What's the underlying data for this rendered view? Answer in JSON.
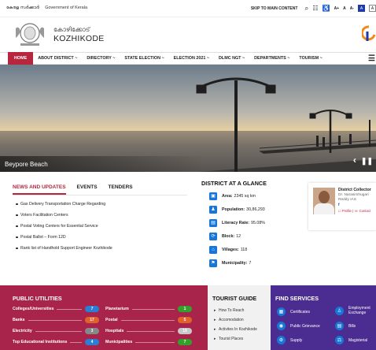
{
  "topbar": {
    "malayalam": "കേരള സർക്കാർ",
    "government": "Government of Kerala",
    "skip": "SKIP TO MAIN CONTENT",
    "font_sizes": [
      "A+",
      "A",
      "A-"
    ],
    "contrast": "A"
  },
  "header": {
    "name_ml": "കോഴിക്കോട്",
    "name_en": "KOZHIKODE"
  },
  "nav": {
    "items": [
      "HOME",
      "ABOUT DISTRICT ~",
      "DIRECTORY ~",
      "STATE ELECTION ~",
      "ELECTION 2021 ~",
      "DLMC NGT ~",
      "DEPARTMENTS ~",
      "TOURISM ~"
    ]
  },
  "hero": {
    "caption": "Beypore Beach"
  },
  "news": {
    "tabs": [
      "NEWS AND UPDATES",
      "EVENTS",
      "TENDERS"
    ],
    "items": [
      "Gas Delivery Transportation Charge Regarding",
      "Voters Facilitation Centers",
      "Postal Voting Centers for Essential Service",
      "Postal Ballot – Form 12D",
      "Rank list of Handhold Support Engineer Kozhikode"
    ]
  },
  "glance": {
    "title": "DISTRICT AT A GLANCE",
    "rows": [
      {
        "label": "Area:",
        "value": "2345 sq km"
      },
      {
        "label": "Population:",
        "value": "30,86,293"
      },
      {
        "label": "Literacy Rate:",
        "value": "95.08%"
      },
      {
        "label": "Block:",
        "value": "12"
      },
      {
        "label": "Villages:",
        "value": "118"
      },
      {
        "label": "Municipality:",
        "value": "7"
      }
    ]
  },
  "collector": {
    "title": "District Collector",
    "name": "Dr. Narasimhugari",
    "name2": "Reddy IAS",
    "fb": "f",
    "links": "☐ Profile | ☏ Contact"
  },
  "utilities": {
    "title": "PUBLIC UTILITIES",
    "items": [
      {
        "label": "Colleges/Universities",
        "count": "7",
        "color": "#2a7fd4"
      },
      {
        "label": "Planetarium",
        "count": "1",
        "color": "#34a02c"
      },
      {
        "label": "Banks",
        "count": "17",
        "color": "#e2622d"
      },
      {
        "label": "Postal",
        "count": "5",
        "color": "#e2622d"
      },
      {
        "label": "Electricity",
        "count": "3",
        "color": "#888888"
      },
      {
        "label": "Hospitals",
        "count": "19",
        "color": "#c9c9c9"
      },
      {
        "label": "Top Educational Institutions",
        "count": "4",
        "color": "#2a7fd4"
      },
      {
        "label": "Municipalities",
        "count": "7",
        "color": "#34a02c"
      }
    ]
  },
  "tourist": {
    "title": "TOURIST GUIDE",
    "items": [
      "How To Reach",
      "Accomodation",
      "Activites In Kozhikode",
      "Tourist Places"
    ]
  },
  "services": {
    "title": "FIND SERVICES",
    "items": [
      "Certificates",
      "Employment Exchange",
      "Public Grievance",
      "Bills",
      "Supply",
      "Magisterial"
    ]
  },
  "colors": {
    "accent": "#b7263d",
    "utilities_bg": "#a8244a",
    "services_bg": "#4b2c91",
    "icon_blue": "#1877d6"
  }
}
